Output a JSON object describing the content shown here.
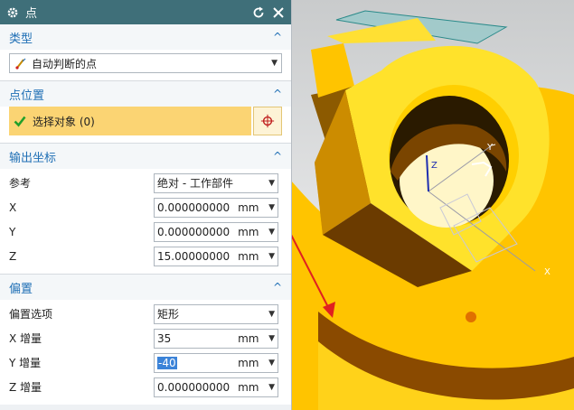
{
  "dialog": {
    "title": "点"
  },
  "sections": {
    "type": {
      "header": "类型",
      "combo_value": "自动判断的点"
    },
    "point_location": {
      "header": "点位置",
      "select_label": "选择对象 (0)"
    },
    "output_coords": {
      "header": "输出坐标",
      "reference": {
        "label": "参考",
        "value": "绝对 - 工作部件"
      },
      "x": {
        "label": "X",
        "value": "0.0000000000",
        "unit": "mm"
      },
      "y": {
        "label": "Y",
        "value": "0.0000000000",
        "unit": "mm"
      },
      "z": {
        "label": "Z",
        "value": "15.0000000000",
        "unit": "mm"
      }
    },
    "offset": {
      "header": "偏置",
      "option": {
        "label": "偏置选项",
        "value": "矩形"
      },
      "x_inc": {
        "label": "X 增量",
        "value": "35",
        "unit": "mm"
      },
      "y_inc": {
        "label": "Y 增量",
        "value": "-40",
        "unit": "mm"
      },
      "z_inc": {
        "label": "Z 增量",
        "value": "0.0000000000",
        "unit": "mm"
      }
    }
  },
  "viewport": {
    "axis_labels": {
      "x": "X",
      "y": "Y",
      "z": "Z"
    }
  },
  "colors": {
    "titlebar": "#3f6f79",
    "section_header": "#1f6fb5",
    "selection": "#fbd473",
    "part_yellow": "#ffd700",
    "part_shadow": "#8a4a00",
    "arrow": "#e02020"
  },
  "icons": [
    "gear-icon",
    "reset-icon",
    "close-icon",
    "collapse-icon",
    "dropdown-icon",
    "point-infer-icon",
    "checkmark-icon",
    "point-constructor-icon"
  ]
}
